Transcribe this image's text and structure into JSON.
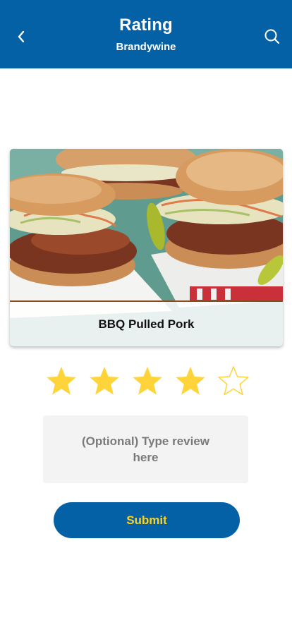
{
  "header": {
    "title": "Rating",
    "subtitle": "Brandywine",
    "back_icon": "chevron-left-icon",
    "search_icon": "search-icon"
  },
  "card": {
    "item_name": "BBQ Pulled Pork",
    "image": "bbq-pulled-pork-sandwiches-photo"
  },
  "rating": {
    "value": 4,
    "max": 5,
    "filled_color": "#ffd43b",
    "empty_color": "#ffd43b"
  },
  "review": {
    "placeholder": "(Optional) Type review here"
  },
  "submit": {
    "label": "Submit"
  },
  "colors": {
    "brand_blue": "#0561a6",
    "accent_yellow": "#ffd21f",
    "input_bg": "#f3f3f3"
  }
}
